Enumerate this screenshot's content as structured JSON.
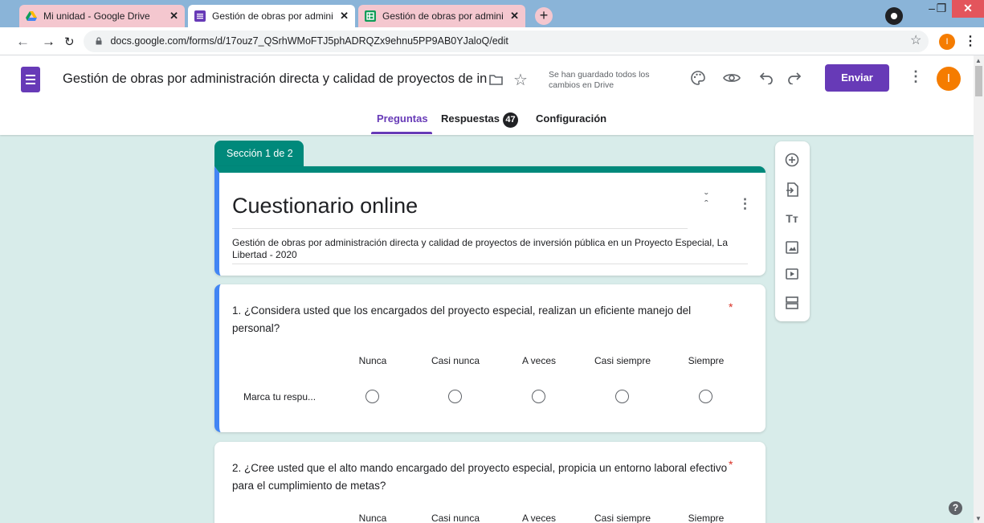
{
  "browser": {
    "tabs": [
      {
        "label": "Mi unidad - Google Drive",
        "icon": "google-drive-icon"
      },
      {
        "label": "Gestión de obras por administrac",
        "icon": "google-forms-icon"
      },
      {
        "label": "Gestión de obras por administrac",
        "icon": "google-sheets-icon"
      }
    ],
    "new_tab": "+",
    "url": "docs.google.com/forms/d/17ouz7_QSrhWMoFTJ5phADRQZx9ehnu5PP9AB0YJaloQ/edit",
    "avatar_letter": "I"
  },
  "header": {
    "doc_title": "Gestión de obras por administración directa y calidad de proyectos de inversión pública",
    "saved_status": "Se han guardado todos los cambios en Drive",
    "send_label": "Enviar",
    "avatar_letter": "I",
    "tabs": [
      {
        "label": "Preguntas",
        "active": true
      },
      {
        "label": "Respuestas",
        "badge": "47"
      },
      {
        "label": "Configuración"
      }
    ]
  },
  "section": {
    "label": "Sección 1 de 2",
    "title": "Cuestionario online",
    "description": "Gestión de obras por administración directa y calidad de proyectos de inversión pública en un Proyecto Especial, La Libertad - 2020"
  },
  "questions": [
    {
      "text": "1. ¿Considera usted que los encargados del proyecto especial, realizan un eficiente manejo del personal?",
      "required_mark": "*",
      "columns": [
        "Nunca",
        "Casi nunca",
        "A veces",
        "Casi siempre",
        "Siempre"
      ],
      "row_label": "Marca tu respu..."
    },
    {
      "text": "2. ¿Cree usted que el alto mando encargado del proyecto especial, propicia un entorno laboral efectivo para el cumplimiento de metas?",
      "required_mark": "*",
      "columns": [
        "Nunca",
        "Casi nunca",
        "A veces",
        "Casi siempre",
        "Siempre"
      ]
    }
  ],
  "side_toolbar": [
    "add-question-icon",
    "import-questions-icon",
    "add-title-icon",
    "add-image-icon",
    "add-video-icon",
    "add-section-icon"
  ],
  "colors": {
    "accent": "#673ab7",
    "section": "#00897b",
    "active_question": "#4285f4",
    "background": "#d8ecea"
  }
}
